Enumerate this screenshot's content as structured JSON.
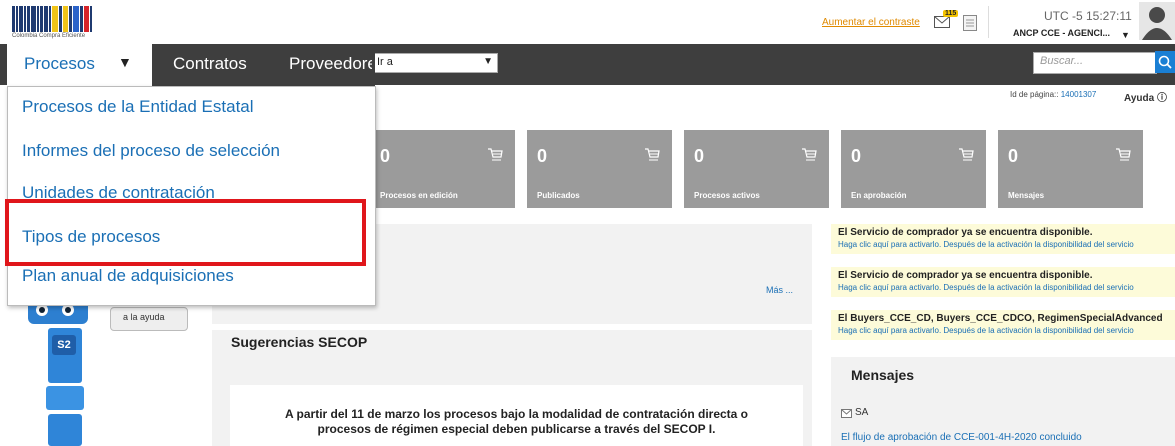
{
  "header": {
    "logo_text": "Colombia Compra Eficiente",
    "contrast_link": "Aumentar el contraste",
    "mail_count": "115",
    "time": "UTC -5 15:27:11",
    "agency": "ANCP CCE - AGENCI..."
  },
  "nav": {
    "tabs": [
      {
        "label": "Procesos",
        "active": true
      },
      {
        "label": "Contratos",
        "active": false
      },
      {
        "label": "Proveedores",
        "active": false
      }
    ],
    "goto_placeholder": "Ir a",
    "search_placeholder": "Buscar..."
  },
  "menu": {
    "items": [
      "Procesos de la Entidad Estatal",
      "Informes del proceso de selección",
      "Unidades de contratación",
      "Tipos de procesos",
      "Plan anual de adquisiciones"
    ],
    "highlighted_index": 3
  },
  "page": {
    "id_label": "Id de página::",
    "id_value": "14001307",
    "help": "Ayuda"
  },
  "tiles": [
    {
      "value": "0",
      "label": "Procesos en edición"
    },
    {
      "value": "0",
      "label": "Publicados"
    },
    {
      "value": "0",
      "label": "Procesos activos"
    },
    {
      "value": "0",
      "label": "En aprobación"
    },
    {
      "value": "0",
      "label": "Mensajes"
    }
  ],
  "panel": {
    "more_link": "Más ..."
  },
  "suggestions": {
    "title": "Sugerencias SECOP",
    "text_line1": "A partir del 11 de marzo los procesos bajo la modalidad de contratación directa o",
    "text_line2": "procesos de régimen especial deben publicarse a través del SECOP I."
  },
  "notices": [
    {
      "title": "El Servicio de comprador ya se encuentra disponible.",
      "body": "Haga clic aquí para activarlo. Después de la activación la disponibilidad del servicio"
    },
    {
      "title": "El Servicio de comprador ya se encuentra disponible.",
      "body": "Haga clic aquí para activarlo. Después de la activación la disponibilidad del servicio"
    },
    {
      "title": "El Buyers_CCE_CD, Buyers_CCE_CDCO, RegimenSpecialAdvanced",
      "body": "Haga clic aquí para activarlo. Después de la activación la disponibilidad del servicio"
    }
  ],
  "messages": {
    "title": "Mensajes",
    "sender": "SA",
    "link": "El flujo de aprobación de CCE-001-4H-2020 concluido"
  },
  "assistant": {
    "bubble": "a la ayuda",
    "badge": "S2"
  },
  "colors": {
    "nav_bg": "#3e3e3e",
    "link_blue": "#1a6fb5",
    "tile_gray": "#9b9b9b",
    "highlight_red": "#e0161b",
    "notice_bg": "#fdfbd9"
  }
}
